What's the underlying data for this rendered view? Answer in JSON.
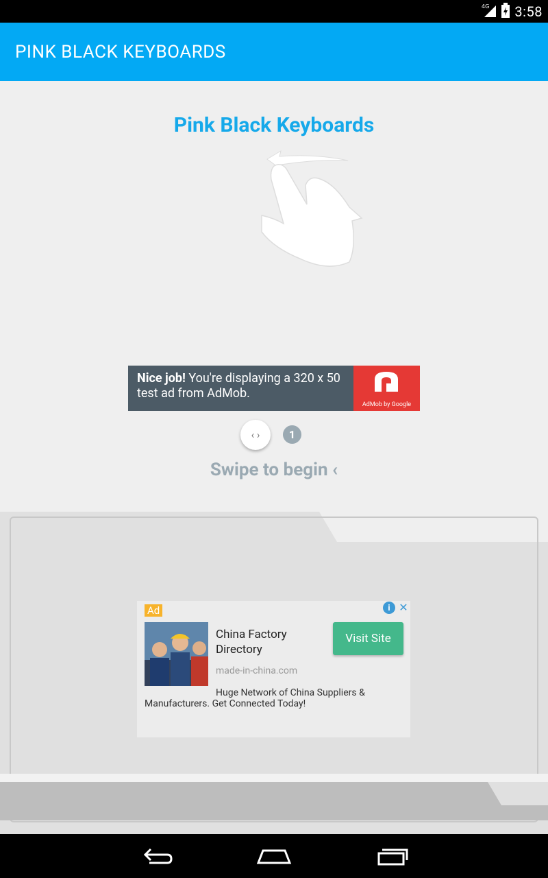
{
  "status_bar": {
    "network": "4G",
    "time": "3:58"
  },
  "app_bar": {
    "title": "PINK BLACK KEYBOARDS"
  },
  "main": {
    "heading": "Pink Black Keyboards",
    "swipe_hint": "Swipe to begin",
    "page_number": "1"
  },
  "admob_banner": {
    "bold_text": "Nice job!",
    "text": " You're displaying a 320 x 50 test ad from AdMob.",
    "logo_caption": "AdMob by Google"
  },
  "native_ad": {
    "badge": "Ad",
    "title": "China Factory Directory",
    "domain": "made-in-china.com",
    "description": "Huge Network of China Suppliers & Manufacturers. Get Connected Today!",
    "cta": "Visit Site"
  },
  "colors": {
    "app_bar": "#03a9f4",
    "heading": "#16a9ea",
    "cta": "#44b88b"
  }
}
